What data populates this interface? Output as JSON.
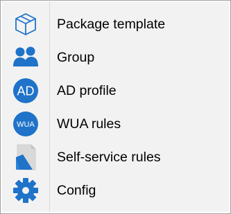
{
  "menu": {
    "items": [
      {
        "label": "Package template",
        "icon": "package-cube-icon"
      },
      {
        "label": "Group",
        "icon": "group-users-icon"
      },
      {
        "label": "AD profile",
        "icon": "ad-profile-icon",
        "icon_text": "AD"
      },
      {
        "label": "WUA rules",
        "icon": "wua-rules-icon",
        "icon_text": "WUA"
      },
      {
        "label": "Self-service rules",
        "icon": "self-service-icon"
      },
      {
        "label": "Config",
        "icon": "gear-icon"
      }
    ]
  },
  "colors": {
    "accent": "#1f73c9",
    "menu_background": "#f2f2f2",
    "border": "#a0a0a0"
  }
}
